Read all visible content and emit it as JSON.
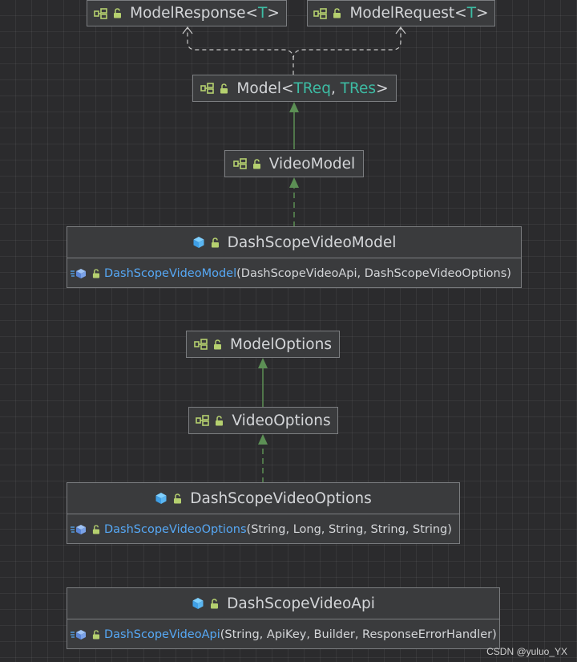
{
  "nodes": {
    "model_response": {
      "name": "ModelResponse",
      "lt": "<",
      "tp": "T",
      "gt": ">"
    },
    "model_request": {
      "name": "ModelRequest",
      "lt": "<",
      "tp": "T",
      "gt": ">"
    },
    "model": {
      "name": "Model",
      "lt": "<",
      "tp1": "TReq",
      "sep": ", ",
      "tp2": "TRes",
      "gt": ">"
    },
    "video_model": {
      "name": "VideoModel"
    },
    "dashscope_video_model": {
      "name": "DashScopeVideoModel",
      "ctor_name": "DashScopeVideoModel",
      "ctor_params": "(DashScopeVideoApi, DashScopeVideoOptions)"
    },
    "model_options": {
      "name": "ModelOptions"
    },
    "video_options": {
      "name": "VideoOptions"
    },
    "dashscope_video_options": {
      "name": "DashScopeVideoOptions",
      "ctor_name": "DashScopeVideoOptions",
      "ctor_params": "(String, Long, String, String, String)"
    },
    "dashscope_video_api": {
      "name": "DashScopeVideoApi",
      "ctor_name": "DashScopeVideoApi",
      "ctor_params": "(String, ApiKey, Builder, ResponseErrorHandler)"
    }
  },
  "watermark": "CSDN @yuluo_YX",
  "colors": {
    "background": "#2b2b2d",
    "node_fill": "#3a3b3d",
    "node_border": "#7b7d80",
    "type_param": "#3dbca4",
    "method_name": "#56a8f5",
    "inheritance_arrow": "#5c8f55",
    "dependency_arrow": "#c8c8c8"
  },
  "icons": {
    "interface": "interface-icon",
    "class": "class-icon",
    "visibility": "unlock-icon",
    "constructor": "constructor-icon"
  }
}
